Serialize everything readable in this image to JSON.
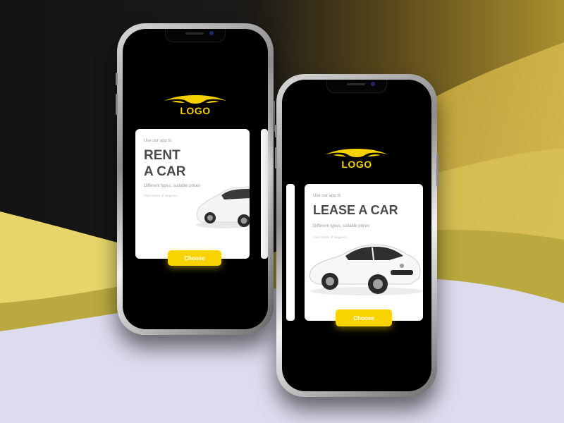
{
  "phones": [
    {
      "logo": "LOGO",
      "card": {
        "subtitle": "Use our app to",
        "title_line1": "RENT",
        "title_line2": "A CAR",
        "description": "Different types, suitable prices",
        "note": "Your choice of elegance"
      },
      "button": "Choose"
    },
    {
      "logo": "LOGO",
      "card": {
        "subtitle": "Use our app to",
        "title": "LEASE A CAR",
        "description": "Different types, suitable prices",
        "note": "Your choice of elegance"
      },
      "button": "Choose"
    }
  ],
  "colors": {
    "accent": "#f6d100",
    "screen": "#000000",
    "card": "#ffffff",
    "title_text": "#4a4a4a"
  },
  "icons": [
    "car-headlight-logo-icon",
    "white-car-image"
  ]
}
